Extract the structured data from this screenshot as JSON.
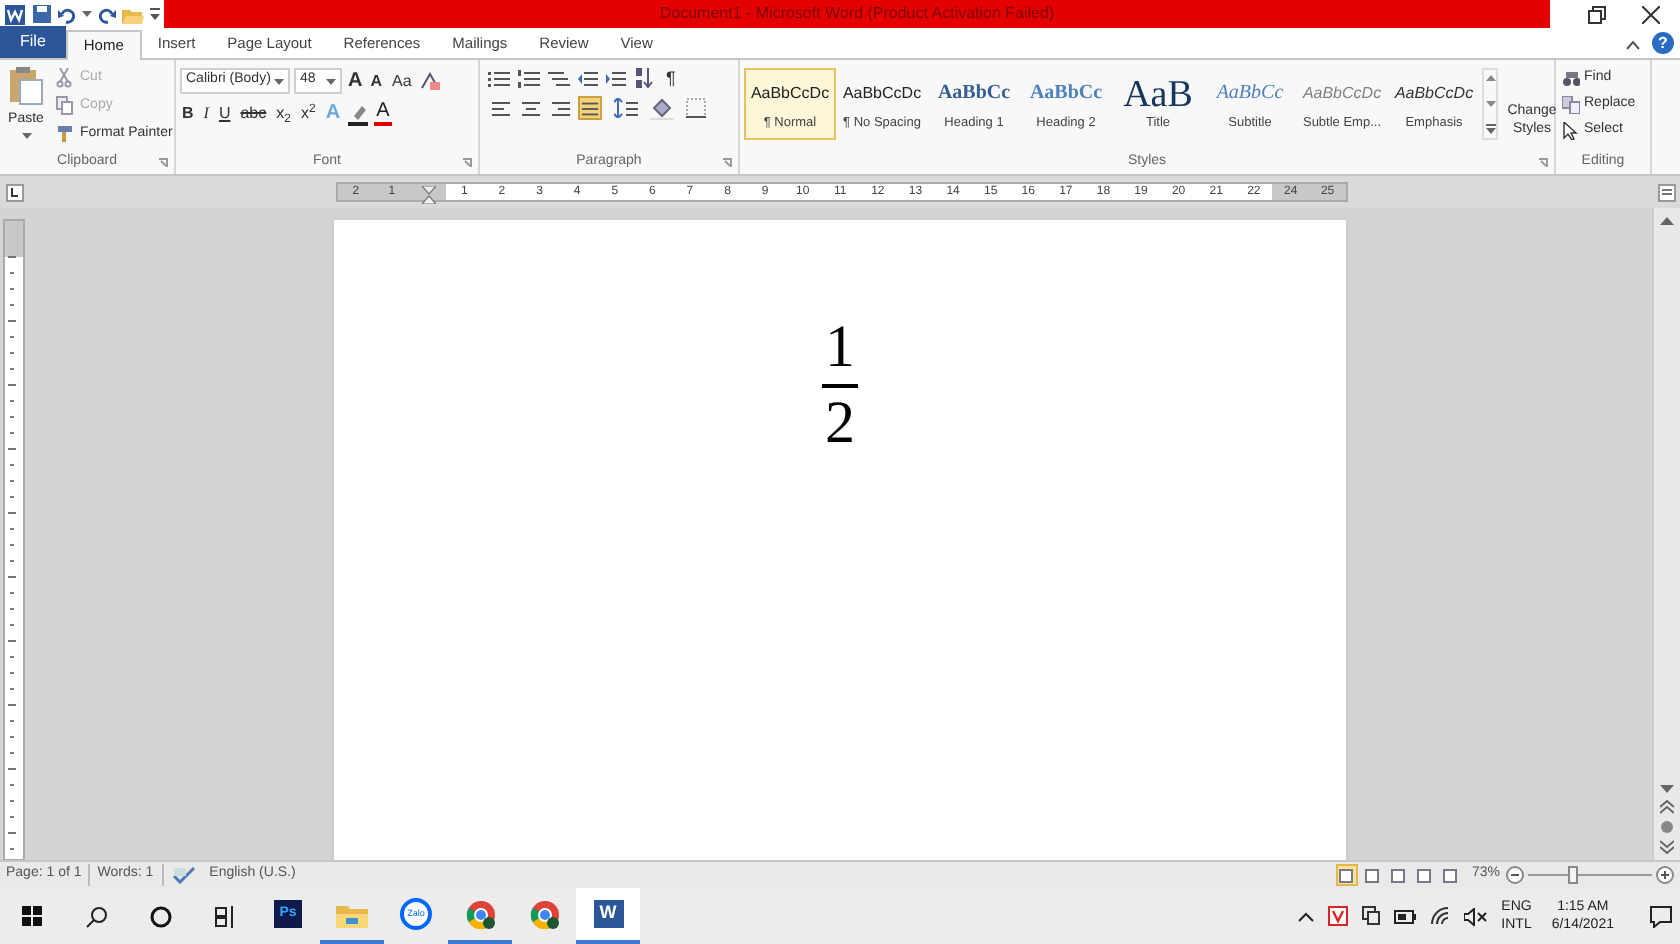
{
  "window": {
    "title": "Document1 - Microsoft Word (Product Activation Failed)"
  },
  "tabs": [
    {
      "label": "File",
      "kind": "file",
      "selected": false
    },
    {
      "label": "Home",
      "kind": "tab",
      "selected": true
    },
    {
      "label": "Insert",
      "kind": "tab",
      "selected": false
    },
    {
      "label": "Page Layout",
      "kind": "tab",
      "selected": false
    },
    {
      "label": "References",
      "kind": "tab",
      "selected": false
    },
    {
      "label": "Mailings",
      "kind": "tab",
      "selected": false
    },
    {
      "label": "Review",
      "kind": "tab",
      "selected": false
    },
    {
      "label": "View",
      "kind": "tab",
      "selected": false
    }
  ],
  "help": "?",
  "clipboard": {
    "label": "Clipboard",
    "paste": "Paste",
    "items": [
      {
        "label": "Cut",
        "kind": "cut",
        "disabled": true
      },
      {
        "label": "Copy",
        "kind": "copy",
        "disabled": true
      },
      {
        "label": "Format Painter",
        "kind": "painter",
        "disabled": false
      }
    ]
  },
  "font": {
    "label": "Font",
    "name": "Calibri (Body)",
    "size": "48",
    "size_buttons": [
      "A",
      "A"
    ],
    "case_button": "Aa",
    "format_buttons": [
      {
        "label": "B",
        "kind": "bold"
      },
      {
        "label": "I",
        "kind": "italic"
      },
      {
        "label": "U",
        "kind": "underline"
      },
      {
        "label": "abc",
        "kind": "strike"
      },
      {
        "label": "x$_{2}$",
        "kind": "plain"
      },
      {
        "label": "x$^{2}$",
        "kind": "plain"
      }
    ],
    "effects_button": "A",
    "color_button": "A"
  },
  "paragraph": {
    "label": "Paragraph",
    "pilcrow": "¶",
    "alignment": [
      {
        "selected": false
      },
      {
        "selected": false
      },
      {
        "selected": false
      },
      {
        "selected": true
      }
    ]
  },
  "styles": {
    "label": "Styles",
    "change_styles": "Change Styles",
    "items": [
      {
        "preview": "AaBbCcDc",
        "name": "¶ Normal",
        "kind": "normal",
        "selected": true
      },
      {
        "preview": "AaBbCcDc",
        "name": "¶ No Spacing",
        "kind": "normal",
        "selected": false
      },
      {
        "preview": "AaBbCc",
        "name": "Heading 1",
        "kind": "heading1",
        "selected": false
      },
      {
        "preview": "AaBbCc",
        "name": "Heading 2",
        "kind": "heading2",
        "selected": false
      },
      {
        "preview": "AaB",
        "name": "Title",
        "kind": "title",
        "selected": false
      },
      {
        "preview": "AaBbCc",
        "name": "Subtitle",
        "kind": "subtitle",
        "selected": false
      },
      {
        "preview": "AaBbCcDc",
        "name": "Subtle Emp...",
        "kind": "subtle",
        "selected": false
      },
      {
        "preview": "AaBbCcDc",
        "name": "Emphasis",
        "kind": "emphasis",
        "selected": false
      }
    ]
  },
  "editing": {
    "label": "Editing",
    "items": [
      {
        "label": "Find",
        "kind": "find"
      },
      {
        "label": "Replace",
        "kind": "replace"
      },
      {
        "label": "Select",
        "kind": "select"
      }
    ]
  },
  "ruler": {
    "left_labels": [
      "2",
      "1"
    ],
    "labels": [
      "1",
      "2",
      "3",
      "4",
      "5",
      "6",
      "7",
      "8",
      "9",
      "10",
      "11",
      "12",
      "13",
      "14",
      "15",
      "16",
      "17",
      "18",
      "19",
      "20",
      "21",
      "22"
    ],
    "right_labels": [
      "24",
      "25"
    ]
  },
  "document": {
    "numerator": "1",
    "denominator": "2"
  },
  "status_bar": {
    "page": "Page: 1 of 1",
    "words": "Words: 1",
    "language": "English (U.S.)",
    "views": [
      {
        "selected": true
      },
      {
        "selected": false
      },
      {
        "selected": false
      },
      {
        "selected": false
      },
      {
        "selected": false
      }
    ],
    "zoom": "73%",
    "zoom_slider": {
      "level": 0.35
    }
  },
  "taskbar": {
    "apps": [
      {
        "kind": "photoshop",
        "label": "Ps",
        "running": false,
        "active": false
      },
      {
        "kind": "explorer",
        "running": true,
        "active": false
      },
      {
        "kind": "zalo",
        "label": "Zalo",
        "running": false,
        "active": false
      },
      {
        "kind": "chrome",
        "running": true,
        "active": false
      },
      {
        "kind": "chrome",
        "running": false,
        "active": false
      },
      {
        "kind": "word",
        "label": "W",
        "running": true,
        "active": true
      }
    ],
    "language": [
      "ENG",
      "INTL"
    ],
    "time": "1:15 AM",
    "date": "6/14/2021"
  }
}
